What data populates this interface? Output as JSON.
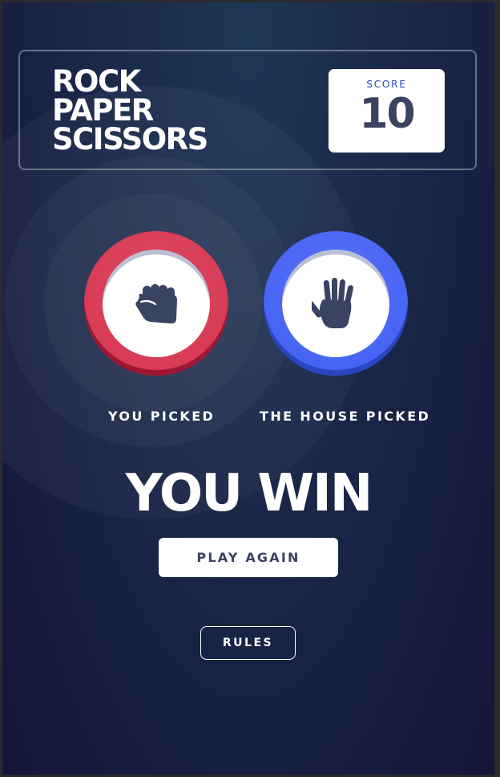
{
  "header": {
    "title_lines": [
      "ROCK",
      "PAPER",
      "SCISSORS"
    ],
    "score_label": "SCORE",
    "score_value": "10"
  },
  "game": {
    "you_picked_label": "YOU PICKED",
    "house_picked_label": "THE HOUSE PICKED",
    "player_choice": "rock",
    "house_choice": "paper",
    "result": "YOU WIN",
    "play_again_label": "PLAY AGAIN"
  },
  "footer": {
    "rules_label": "RULES"
  },
  "colors": {
    "rock": "#dc2e4e",
    "paper": "#4865f4",
    "score_label": "#2a46c0",
    "dark_text": "#3b4363",
    "bg_top": "#1f3756",
    "bg_bottom": "#141539"
  },
  "icons": {
    "player_icon": "rock-fist-icon",
    "house_icon": "paper-hand-icon"
  }
}
